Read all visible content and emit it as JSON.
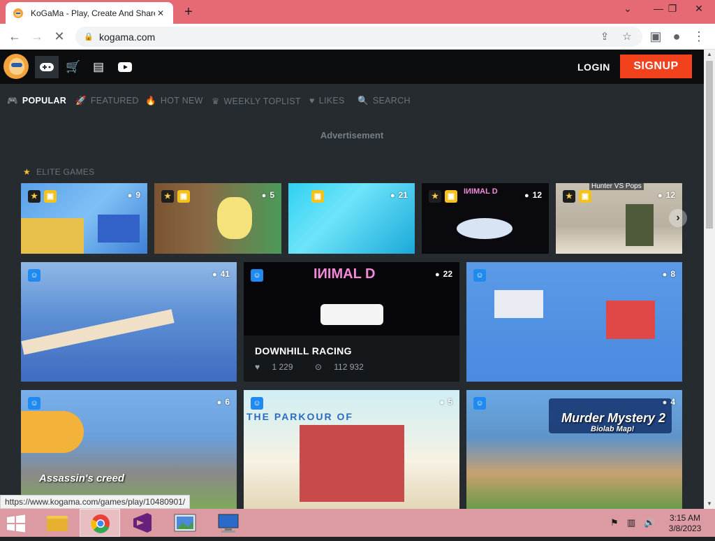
{
  "browser": {
    "tab_title": "KoGaMa - Play, Create And Share",
    "tab_close": "✕",
    "new_tab": "+",
    "url": "kogama.com",
    "window_controls": [
      "⌄",
      "—",
      "❐",
      "✕"
    ]
  },
  "site": {
    "login": "LOGIN",
    "signup": "SIGNUP",
    "header_icons": [
      "gamepad-icon",
      "cart-icon",
      "news-icon",
      "youtube-icon"
    ]
  },
  "subnav": [
    {
      "label": "POPULAR",
      "icon": "gamepad-icon",
      "active": true
    },
    {
      "label": "FEATURED",
      "icon": "rocket-icon",
      "active": false
    },
    {
      "label": "HOT NEW",
      "icon": "fire-icon",
      "active": false
    },
    {
      "label": "WEEKLY TOPLIST",
      "icon": "crown-icon",
      "active": false
    },
    {
      "label": "LIKES",
      "icon": "heart-icon",
      "active": false
    },
    {
      "label": "SEARCH",
      "icon": "search-icon",
      "active": false
    }
  ],
  "advertisement": "Advertisement",
  "elite_label": "ELITE GAMES",
  "elite_games": [
    {
      "players": "9"
    },
    {
      "players": "5"
    },
    {
      "players": "21"
    },
    {
      "players": "12",
      "art_text": "IИIMAL D"
    },
    {
      "players": "12",
      "art_text": "Hunter VS Pops"
    }
  ],
  "games_row1": [
    {
      "players": "41"
    },
    {
      "players": "22",
      "title": "DOWNHILL RACING",
      "likes": "1 229",
      "plays": "112 932"
    },
    {
      "players": "8"
    }
  ],
  "games_row2": [
    {
      "players": "6",
      "art_text": "Assassin's creed"
    },
    {
      "players": "5",
      "art_text": "THE PARKOUR OF"
    },
    {
      "players": "4",
      "art_text": "Murder Mystery 2",
      "art_subtext": "Biolab Map!"
    }
  ],
  "status_url": "https://www.kogama.com/games/play/10480901/",
  "clock": {
    "time": "3:15 AM",
    "date": "3/8/2023"
  },
  "colors": {
    "signup": "#f1421d",
    "header": "#0b0d0f",
    "body": "#262b30",
    "taskbar": "#dc9ba3",
    "tabstrip": "#e56a73"
  }
}
